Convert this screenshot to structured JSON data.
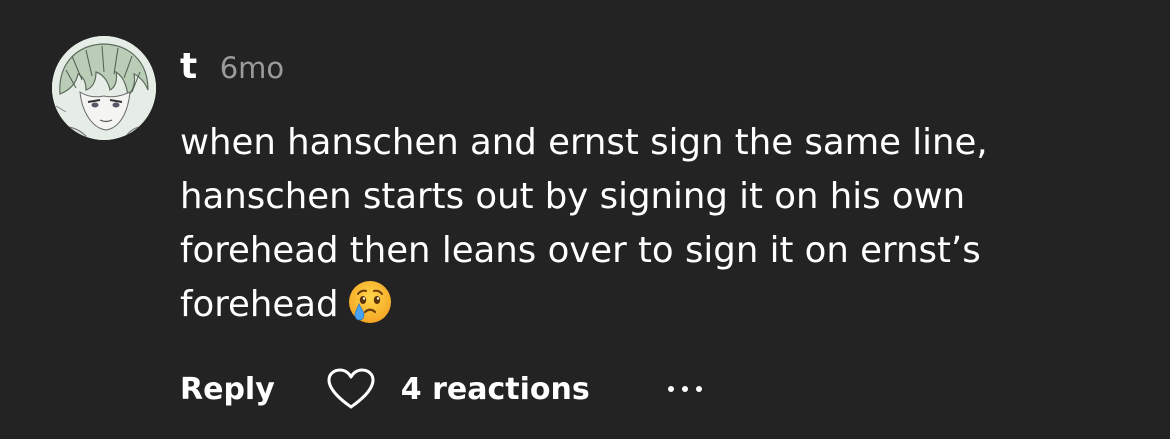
{
  "comment": {
    "author": "t",
    "age": "6mo",
    "text": "when hanschen and ernst sign the same line, hanschen starts out by signing it on his own forehead then leans over to sign it on ernst’s forehead",
    "emoji": "face-holding-back-tears",
    "actions": {
      "reply_label": "Reply",
      "reactions_label": "4 reactions",
      "more_icon": "ellipsis-icon",
      "heart_icon": "heart-outline-icon"
    }
  },
  "colors": {
    "background": "#232323",
    "text": "#ffffff",
    "muted": "#9a9a9a"
  }
}
